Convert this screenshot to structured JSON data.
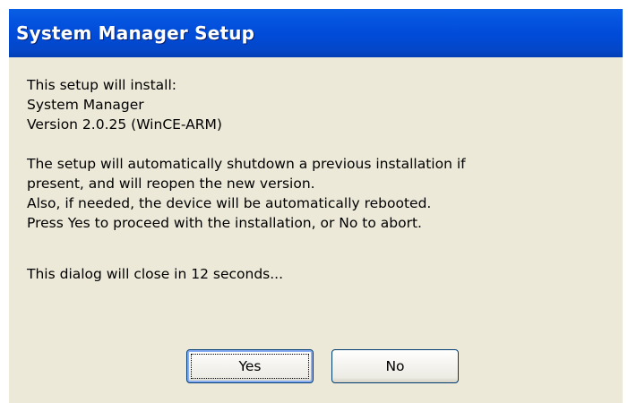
{
  "dialog": {
    "title": "System Manager Setup",
    "lines_block1": [
      "This setup will install:",
      "System Manager",
      "Version 2.0.25 (WinCE-ARM)"
    ],
    "lines_block2": [
      "The setup will automatically shutdown a previous installation if",
      "present, and will reopen the new version.",
      "Also, if needed, the device will be automatically rebooted.",
      "Press Yes to proceed with the installation, or No to abort."
    ],
    "countdown_text": "This dialog will close in 12 seconds...",
    "countdown_seconds": 12,
    "yes_label": "Yes",
    "no_label": "No"
  },
  "colors": {
    "titlebar": "#0054e3",
    "dialog_background": "#ece9d8",
    "title_text": "#ffffff"
  }
}
